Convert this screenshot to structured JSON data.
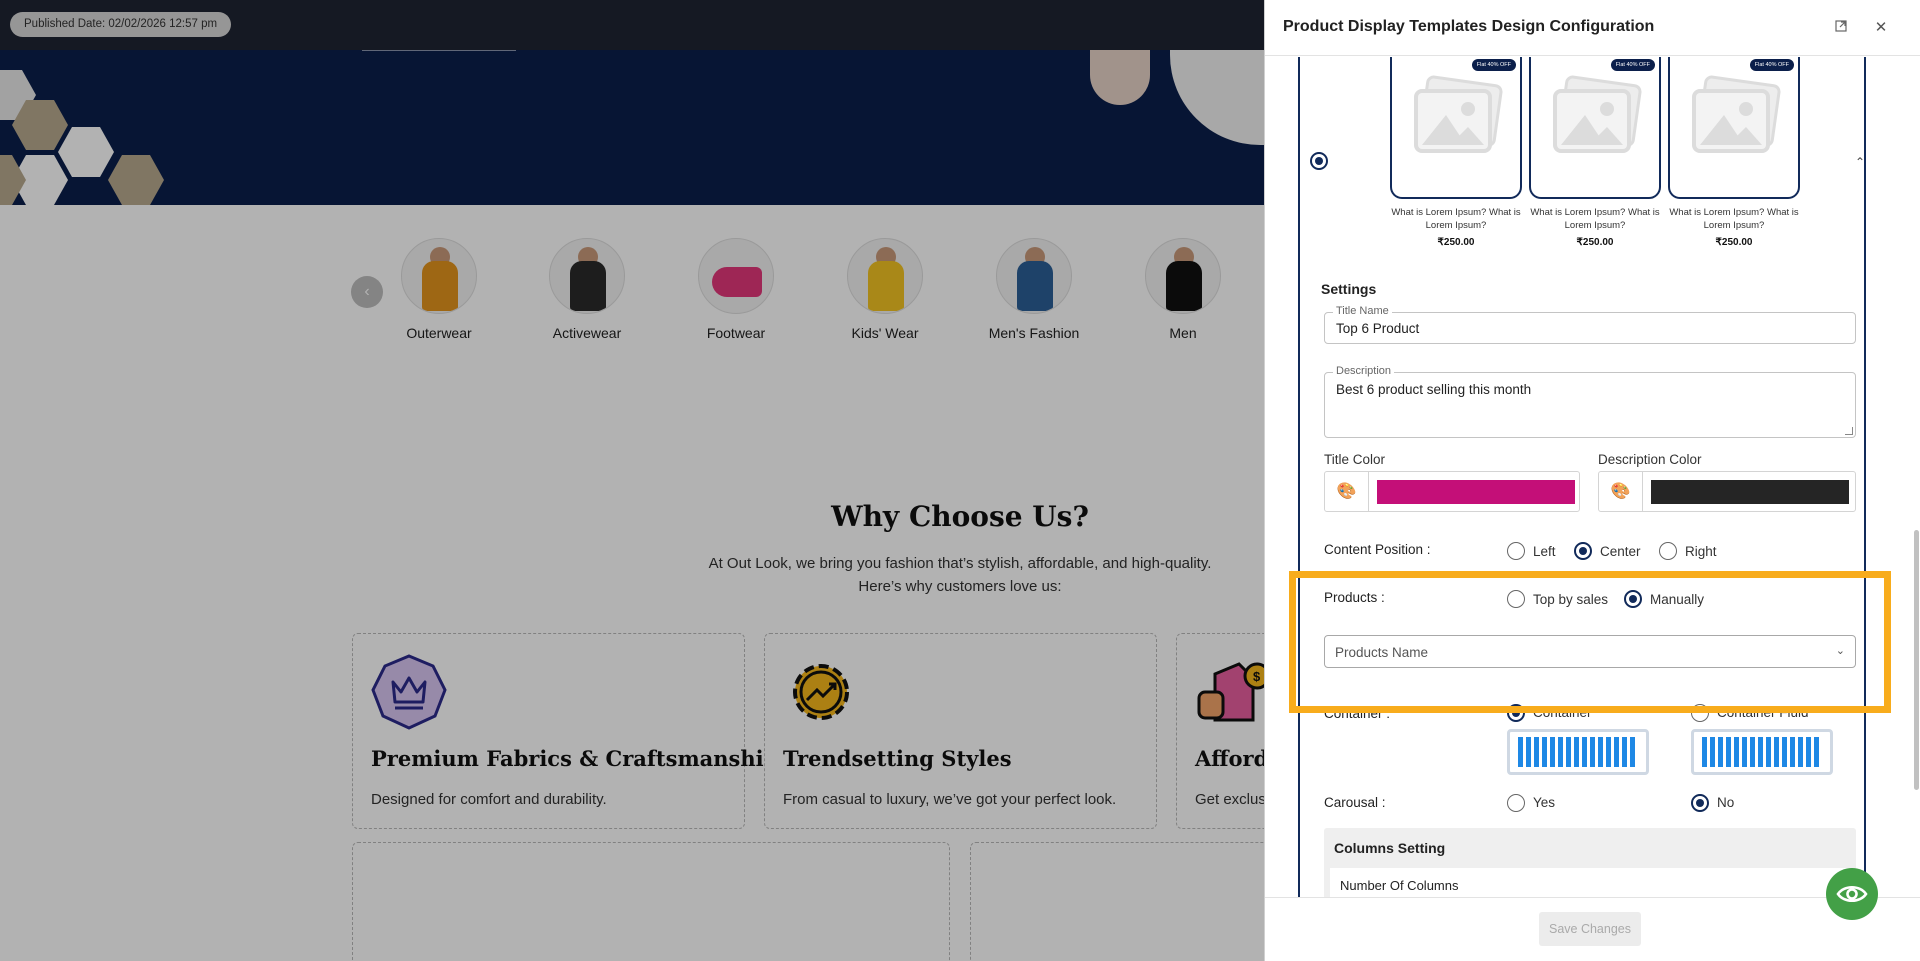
{
  "site": {
    "published_label": "Published Date: 02/02/2026 12:57 pm",
    "categories": [
      {
        "label": "Outerwear",
        "color": "#e3941e"
      },
      {
        "label": "Activewear",
        "color": "#2a2a2a"
      },
      {
        "label": "Footwear",
        "color": "#e2377a"
      },
      {
        "label": "Kids' Wear",
        "color": "#f2c323"
      },
      {
        "label": "Men's Fashion",
        "color": "#2c5f97"
      },
      {
        "label": "Men",
        "color": "#111111"
      }
    ],
    "why_title": "Why Choose Us?",
    "why_sub_line1": "At Out Look, we bring you fashion that’s stylish, affordable, and high-quality.",
    "why_sub_line2": "Here’s why customers love us:",
    "features": [
      {
        "title": "Premium Fabrics & Craftsmanship",
        "desc": "Designed for comfort and durability.",
        "icon": "crown-icon"
      },
      {
        "title": "Trendsetting Styles",
        "desc": "From casual to luxury, we’ve got your perfect look.",
        "icon": "gear-trend-icon"
      },
      {
        "title": "Afforda",
        "desc": "Get exclus",
        "icon": "price-tag-icon"
      }
    ]
  },
  "panel": {
    "title": "Product Display Templates Design Configuration",
    "preview_cards": [
      {
        "badge": "Flat 40% OFF",
        "caption_line1": "What is Lorem Ipsum? What is",
        "caption_line2": "Lorem Ipsum?",
        "price": "₹250.00"
      },
      {
        "badge": "Flat 40% OFF",
        "caption_line1": "What is Lorem Ipsum? What is",
        "caption_line2": "Lorem Ipsum?",
        "price": "₹250.00"
      },
      {
        "badge": "Flat 40% OFF",
        "caption_line1": "What is Lorem Ipsum? What is",
        "caption_line2": "Lorem Ipsum?",
        "price": "₹250.00"
      }
    ],
    "settings_heading": "Settings",
    "title_name": {
      "label": "Title Name",
      "value": "Top 6 Product"
    },
    "description": {
      "label": "Description",
      "value": "Best 6 product selling this month"
    },
    "title_color": {
      "label": "Title Color",
      "hex": "#c40f78"
    },
    "description_color": {
      "label": "Description Color",
      "hex": "#252525"
    },
    "content_position": {
      "label": "Content Position :",
      "options": [
        "Left",
        "Center",
        "Right"
      ],
      "selected": "Center"
    },
    "products": {
      "label": "Products :",
      "options": [
        "Top by sales",
        "Manually"
      ],
      "selected": "Manually"
    },
    "products_select": {
      "placeholder": "Products Name"
    },
    "container": {
      "label": "Container :",
      "options": [
        "Container",
        "Container Fluid"
      ],
      "selected": "Container"
    },
    "carousal": {
      "label": "Carousal :",
      "options": [
        "Yes",
        "No"
      ],
      "selected": "No"
    },
    "columns_setting": {
      "title": "Columns Setting",
      "number_label": "Number Of Columns"
    },
    "save_label": "Save Changes",
    "accent_color": "#112a5a",
    "highlight_color": "#f8ac1c"
  }
}
